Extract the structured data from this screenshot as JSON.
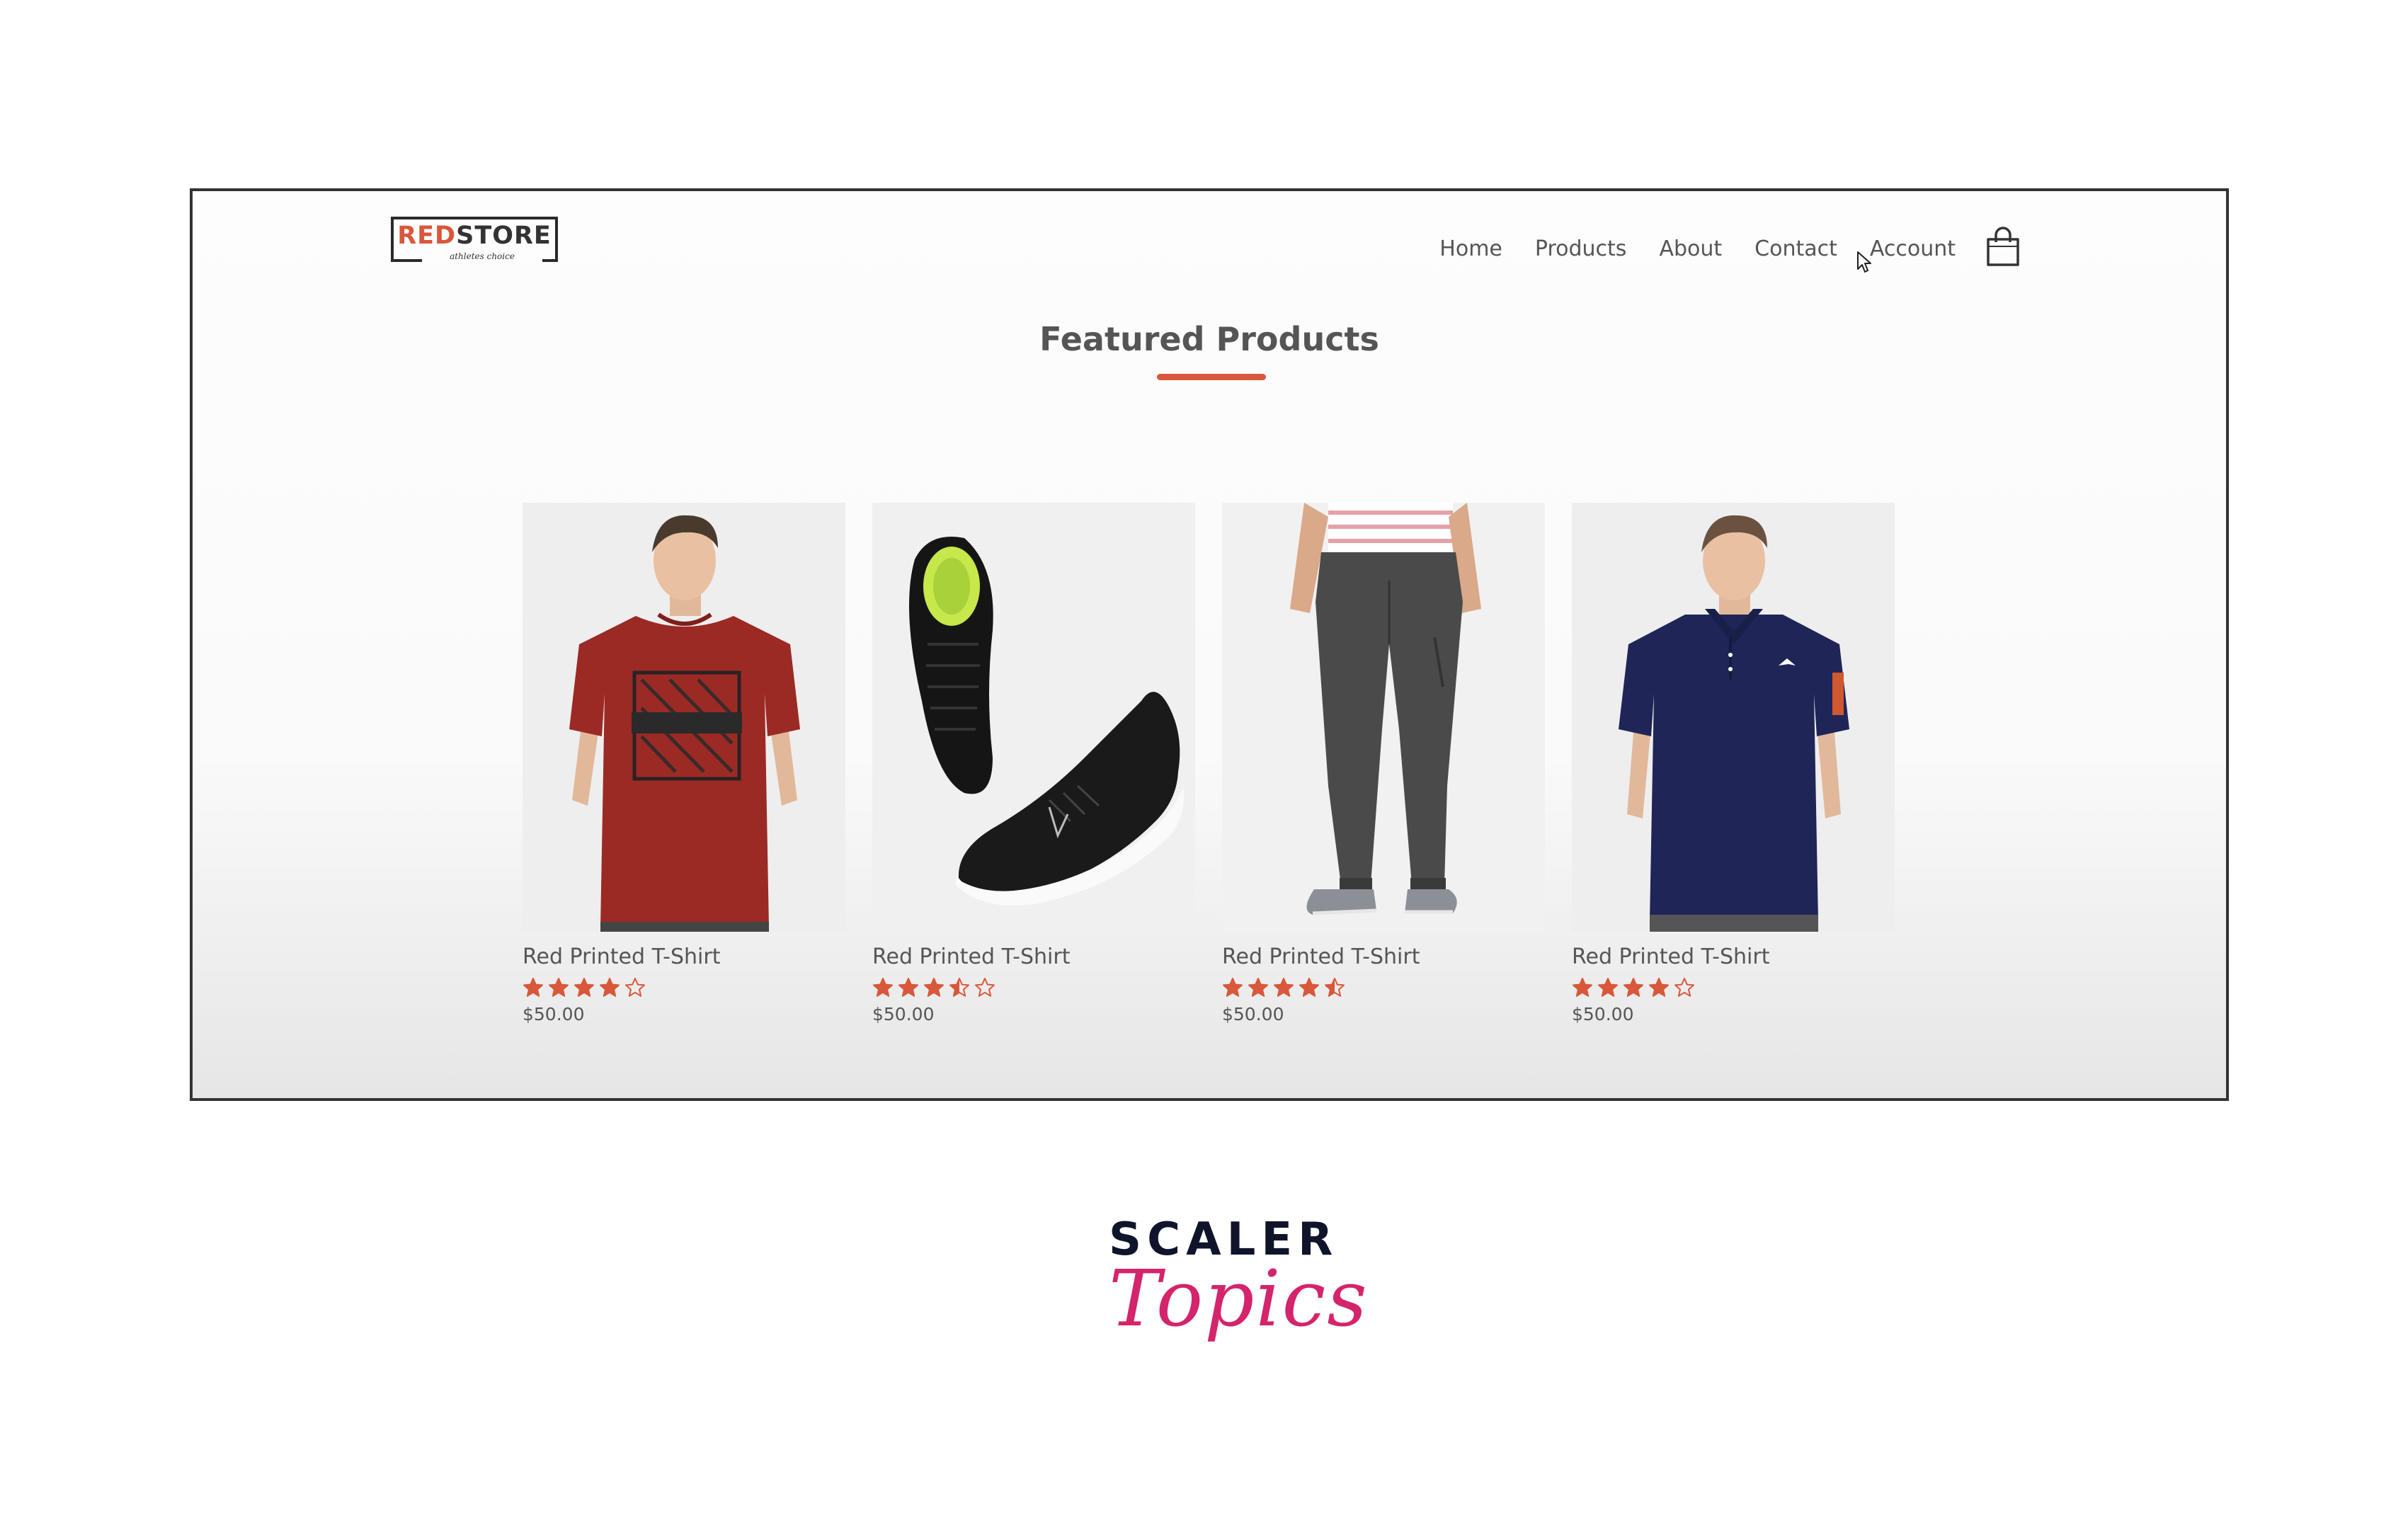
{
  "brand": {
    "logo_part1": "RED",
    "logo_part2": "STORE",
    "logo_tagline": "athletes choice"
  },
  "nav": {
    "items": [
      {
        "label": "Home"
      },
      {
        "label": "Products"
      },
      {
        "label": "About"
      },
      {
        "label": "Contact"
      },
      {
        "label": "Account"
      }
    ],
    "cart_icon": "shopping-bag-icon"
  },
  "section": {
    "title": "Featured Products"
  },
  "products": [
    {
      "name": "Red Printed T-Shirt",
      "rating": 4,
      "price": "$50.00",
      "image": "red-tshirt"
    },
    {
      "name": "Red Printed T-Shirt",
      "rating": 3.5,
      "price": "$50.00",
      "image": "black-sneakers"
    },
    {
      "name": "Red Printed T-Shirt",
      "rating": 4.5,
      "price": "$50.00",
      "image": "grey-joggers"
    },
    {
      "name": "Red Printed T-Shirt",
      "rating": 4,
      "price": "$50.00",
      "image": "navy-polo"
    }
  ],
  "colors": {
    "accent": "#d9573a",
    "text": "#555555",
    "watermark_dark": "#10142b",
    "watermark_pink": "#d4246b"
  },
  "watermark": {
    "line1": "SCALER",
    "line2": "Topics"
  }
}
